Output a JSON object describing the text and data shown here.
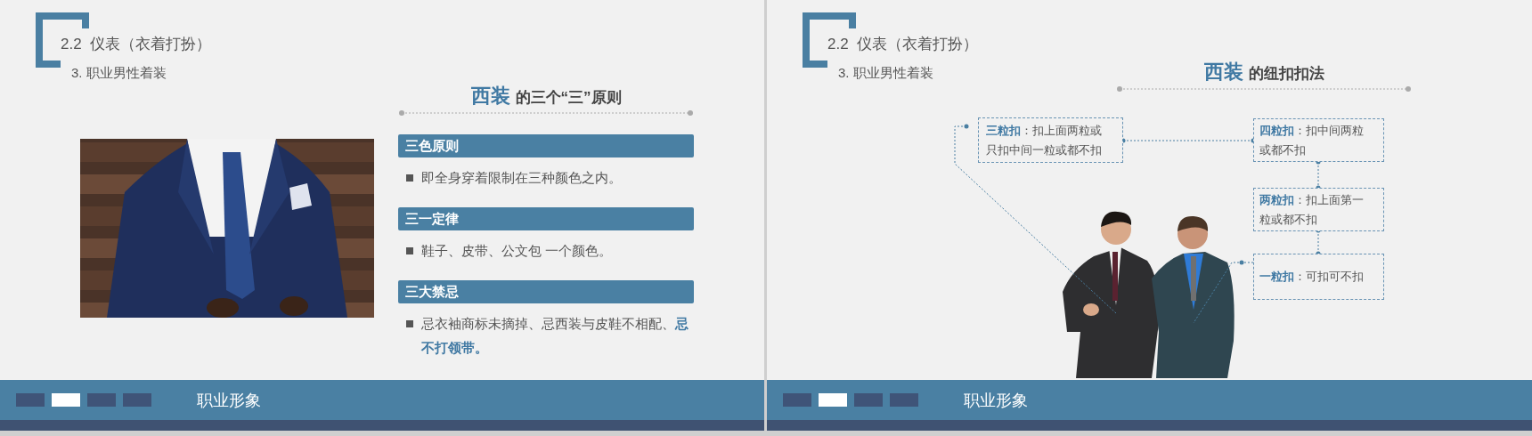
{
  "slides": [
    {
      "kind": "principles",
      "section_title": "2.2  仪表（衣着打扮）",
      "subtitle": "3. 职业男性着装",
      "heading": {
        "accent": "西装",
        "rest": "的三个“三”原则"
      },
      "photo": {
        "kind": "picture"
      },
      "principles": [
        {
          "title": "三色原则",
          "text": "即全身穿着限制在三种颜色之内。"
        },
        {
          "title": "三一定律",
          "text": "鞋子、皮带、公文包 一个颜色。"
        },
        {
          "title": "三大禁忌",
          "text": "忌衣袖商标未摘掉、忌西装与皮鞋不相配、**忌不打领带。**"
        }
      ],
      "footer": {
        "indicators": [
          {
            "selected": false
          },
          {
            "selected": true
          },
          {
            "selected": false
          },
          {
            "selected": false
          }
        ],
        "label": "职业形象"
      }
    },
    {
      "kind": "diagram",
      "section_title": "2.2  仪表（衣着打扮）",
      "subtitle": "3. 职业男性着装",
      "heading": {
        "accent": "西装",
        "rest": "的纽扣扣法"
      },
      "photo": {
        "kind": "picture"
      },
      "notes": [
        {
          "text": "**三粒扣**：扣上面两粒或只扣中间一粒或都不扣"
        },
        {
          "text": "**四粒扣**：扣中间两粒或都不扣"
        },
        {
          "text": "**两粒扣**：扣上面第一粒或都不扣"
        },
        {
          "text": "**一粒扣**：可扣可不扣"
        }
      ],
      "footer": {
        "indicators": [
          {
            "selected": false
          },
          {
            "selected": true
          },
          {
            "selected": false
          },
          {
            "selected": false
          }
        ],
        "label": "职业形象"
      }
    }
  ]
}
